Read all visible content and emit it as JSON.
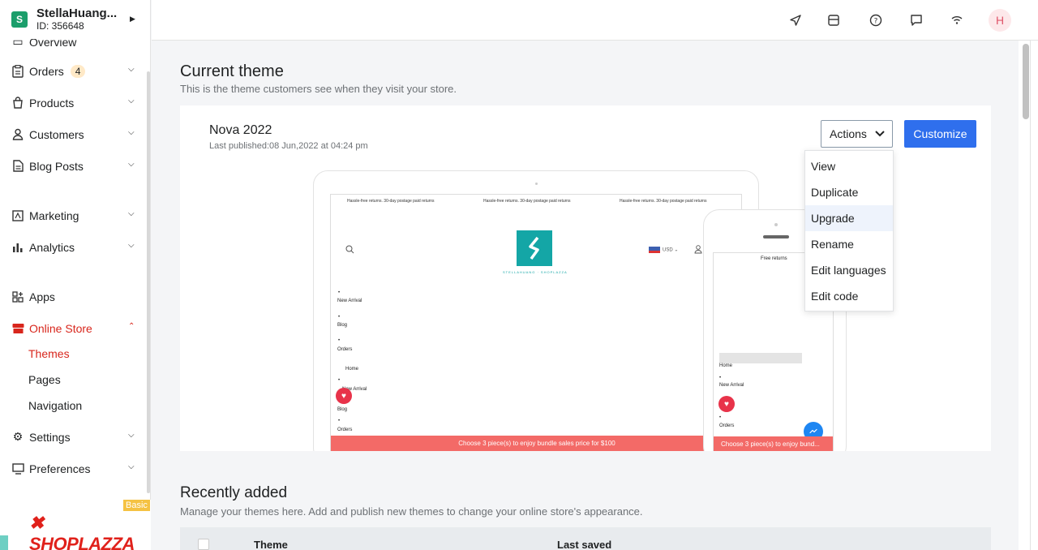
{
  "store": {
    "name": "StellaHuang...",
    "id": "ID: 356648",
    "logo": "S"
  },
  "nav": {
    "partial_top": "Overview",
    "orders": "Orders",
    "orders_badge": "4",
    "products": "Products",
    "customers": "Customers",
    "blog_posts": "Blog Posts",
    "marketing": "Marketing",
    "analytics": "Analytics",
    "apps": "Apps",
    "online_store": "Online Store",
    "themes": "Themes",
    "pages": "Pages",
    "navigation": "Navigation",
    "settings": "Settings",
    "preferences": "Preferences"
  },
  "brand": {
    "plan": "Basic",
    "logo_text": "SHOPLAZZA"
  },
  "topbar": {
    "avatar": "H",
    "icons": [
      "send-icon",
      "storefront-icon",
      "help-icon",
      "chat-icon",
      "wifi-icon"
    ]
  },
  "current_theme": {
    "heading": "Current theme",
    "description": "This is the theme customers see when they visit your store.",
    "name": "Nova 2022",
    "published": "Last published:08 Jun,2022 at 04:24 pm",
    "actions_label": "Actions",
    "customize_label": "Customize"
  },
  "actions_menu": [
    "View",
    "Duplicate",
    "Upgrade",
    "Rename",
    "Edit languages",
    "Edit code"
  ],
  "preview": {
    "announcement": "Hassle-free returns. 30-day postage paid returns",
    "logo_caption": "STELLAHUANG · SHOPLAZZA",
    "currency": "USD",
    "menu": [
      "New Arrival",
      "Blog",
      "Orders",
      "Home",
      "New Arrival",
      "Blog",
      "Orders"
    ],
    "footer": "Choose 3 piece(s) to enjoy bundle sales price for $100",
    "phone_announcement": "Free returns",
    "phone_menu": [
      "Home",
      "New Arrival",
      "Orders"
    ],
    "phone_footer": "Choose 3 piece(s) to enjoy bund..."
  },
  "recently_added": {
    "heading": "Recently added",
    "description": "Manage your themes here. Add and publish new themes to change your online store's appearance.",
    "col_theme": "Theme",
    "col_saved": "Last saved"
  },
  "colors": {
    "accent": "#2f6fed",
    "active": "#d8261c",
    "brand": "#e0211b",
    "sidebar_bg": "#ffffff",
    "page_bg": "#f4f5f7"
  }
}
